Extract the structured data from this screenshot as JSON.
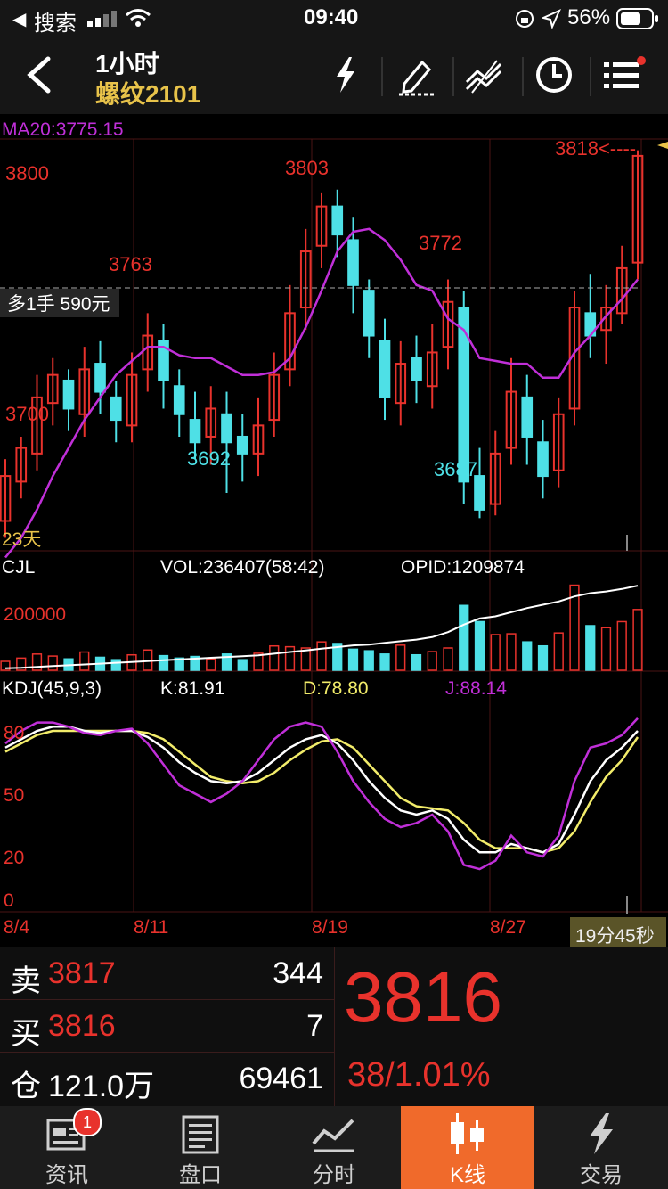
{
  "status_bar": {
    "back_app": "搜索",
    "time": "09:40",
    "battery": "56%"
  },
  "header": {
    "period": "1小时",
    "symbol": "螺纹2101"
  },
  "chart_labels": {
    "ma": "MA20:3775.15",
    "y_3800": "3800",
    "y_3700": "3700",
    "high_3803": "3803",
    "high_3763": "3763",
    "high_3772": "3772",
    "low_3692": "3692",
    "low_3687": "3687",
    "latest": "3818<----",
    "position_tag": "多1手 590元",
    "span": "23天",
    "vol_title": "CJL",
    "vol_value": "VOL:236407(58:42)",
    "opid": "OPID:1209874",
    "vol_axis": "200000",
    "kdj_title": "KDJ(45,9,3)",
    "kdj_k": "K:81.91",
    "kdj_d": "D:78.80",
    "kdj_j": "J:88.14",
    "kdj_80": "80",
    "kdj_50": "50",
    "kdj_20": "20",
    "kdj_0": "0",
    "countdown": "19分45秒"
  },
  "x_dates": [
    "8/4",
    "8/11",
    "8/19",
    "8/27"
  ],
  "colors": {
    "up": "#e8322c",
    "down": "#4ee0e6",
    "ma": "#c02fd8",
    "kdj_k": "#ffffff",
    "kdj_d": "#f2ec6a",
    "kdj_j": "#c02fd8",
    "accent": "#e8c34a",
    "tab_active": "#f06a2b"
  },
  "chart_data": {
    "type": "candlestick",
    "ylim": [
      3676,
      3822
    ],
    "ma20": [
      3673,
      3680,
      3690,
      3702,
      3712,
      3722,
      3730,
      3738,
      3743,
      3748,
      3748,
      3745,
      3744,
      3744,
      3741,
      3738,
      3738,
      3739,
      3744,
      3755,
      3768,
      3782,
      3789,
      3790,
      3786,
      3779,
      3770,
      3768,
      3758,
      3754,
      3744,
      3743,
      3742,
      3742,
      3737,
      3737,
      3746,
      3752,
      3759,
      3765,
      3772
    ],
    "candles": [
      [
        3686,
        3702,
        3680,
        3708
      ],
      [
        3700,
        3712,
        3694,
        3716
      ],
      [
        3710,
        3730,
        3704,
        3738
      ],
      [
        3728,
        3738,
        3720,
        3744
      ],
      [
        3736,
        3726,
        3718,
        3740
      ],
      [
        3724,
        3740,
        3716,
        3748
      ],
      [
        3742,
        3732,
        3724,
        3750
      ],
      [
        3730,
        3722,
        3714,
        3736
      ],
      [
        3720,
        3738,
        3714,
        3746
      ],
      [
        3740,
        3752,
        3732,
        3760
      ],
      [
        3750,
        3736,
        3726,
        3756
      ],
      [
        3734,
        3724,
        3716,
        3740
      ],
      [
        3722,
        3714,
        3708,
        3732
      ],
      [
        3716,
        3726,
        3706,
        3734
      ],
      [
        3724,
        3714,
        3696,
        3732
      ],
      [
        3716,
        3710,
        3700,
        3724
      ],
      [
        3710,
        3720,
        3702,
        3730
      ],
      [
        3722,
        3738,
        3716,
        3746
      ],
      [
        3740,
        3760,
        3734,
        3770
      ],
      [
        3762,
        3782,
        3754,
        3790
      ],
      [
        3784,
        3798,
        3776,
        3803
      ],
      [
        3798,
        3788,
        3780,
        3804
      ],
      [
        3786,
        3770,
        3760,
        3794
      ],
      [
        3768,
        3752,
        3744,
        3772
      ],
      [
        3750,
        3730,
        3722,
        3758
      ],
      [
        3728,
        3742,
        3720,
        3750
      ],
      [
        3744,
        3736,
        3728,
        3752
      ],
      [
        3734,
        3746,
        3726,
        3756
      ],
      [
        3748,
        3764,
        3740,
        3772
      ],
      [
        3762,
        3700,
        3692,
        3768
      ],
      [
        3702,
        3690,
        3687,
        3712
      ],
      [
        3692,
        3710,
        3688,
        3718
      ],
      [
        3712,
        3732,
        3706,
        3744
      ],
      [
        3730,
        3716,
        3706,
        3738
      ],
      [
        3714,
        3702,
        3694,
        3722
      ],
      [
        3704,
        3724,
        3698,
        3730
      ],
      [
        3726,
        3762,
        3720,
        3768
      ],
      [
        3760,
        3752,
        3744,
        3774
      ],
      [
        3754,
        3762,
        3742,
        3770
      ],
      [
        3760,
        3776,
        3756,
        3784
      ],
      [
        3778,
        3816,
        3772,
        3818
      ]
    ],
    "volume": [
      22,
      30,
      40,
      35,
      28,
      45,
      32,
      26,
      38,
      50,
      36,
      30,
      34,
      28,
      40,
      26,
      42,
      60,
      58,
      55,
      70,
      66,
      52,
      48,
      40,
      62,
      38,
      46,
      55,
      160,
      120,
      88,
      90,
      70,
      60,
      92,
      210,
      110,
      105,
      120,
      150
    ],
    "opid": [
      5,
      6,
      8,
      10,
      12,
      14,
      16,
      18,
      20,
      22,
      24,
      26,
      28,
      30,
      32,
      34,
      36,
      40,
      44,
      48,
      52,
      56,
      60,
      62,
      66,
      70,
      74,
      80,
      92,
      110,
      125,
      130,
      140,
      150,
      158,
      166,
      178,
      186,
      190,
      196,
      204
    ],
    "kdj_k": [
      72,
      76,
      80,
      82,
      82,
      80,
      79,
      80,
      80,
      77,
      72,
      65,
      60,
      56,
      55,
      56,
      60,
      66,
      72,
      76,
      78,
      74,
      66,
      56,
      48,
      42,
      40,
      42,
      38,
      28,
      22,
      22,
      26,
      24,
      22,
      26,
      40,
      56,
      66,
      72,
      80
    ],
    "kdj_d": [
      70,
      74,
      78,
      80,
      80,
      80,
      80,
      80,
      80,
      79,
      76,
      70,
      64,
      58,
      56,
      55,
      56,
      60,
      66,
      71,
      75,
      76,
      72,
      64,
      56,
      48,
      44,
      43,
      42,
      36,
      28,
      24,
      24,
      24,
      22,
      24,
      32,
      46,
      58,
      66,
      77
    ],
    "kdj_j": [
      74,
      80,
      84,
      84,
      82,
      79,
      78,
      80,
      81,
      74,
      64,
      54,
      50,
      46,
      50,
      56,
      66,
      76,
      82,
      84,
      82,
      70,
      56,
      46,
      38,
      34,
      36,
      40,
      32,
      16,
      14,
      18,
      30,
      22,
      20,
      30,
      56,
      72,
      74,
      78,
      86
    ]
  },
  "quote": {
    "sell_label": "卖",
    "sell_price": "3817",
    "sell_qty": "344",
    "buy_label": "买",
    "buy_price": "3816",
    "buy_qty": "7",
    "oi_label": "仓",
    "oi_value": "121.0万",
    "oi_qty": "69461",
    "last_price": "3816",
    "change": "38/1.01%"
  },
  "tabs": [
    {
      "label": "资讯",
      "icon": "news-icon",
      "badge": "1"
    },
    {
      "label": "盘口",
      "icon": "orderbook-icon"
    },
    {
      "label": "分时",
      "icon": "timeshare-icon"
    },
    {
      "label": "K线",
      "icon": "candlestick-icon",
      "active": true
    },
    {
      "label": "交易",
      "icon": "lightning-icon"
    }
  ]
}
